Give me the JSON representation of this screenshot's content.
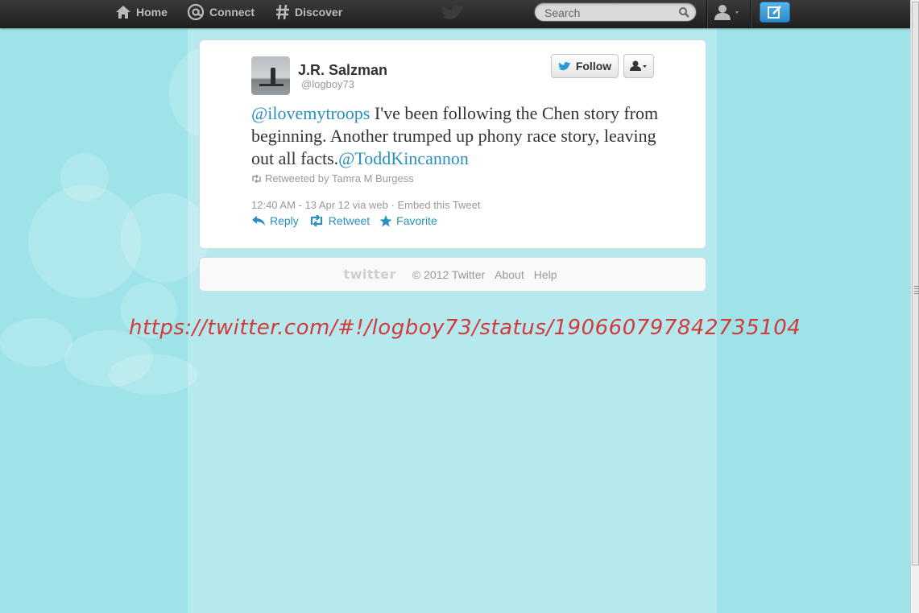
{
  "nav": {
    "home": "Home",
    "connect": "Connect",
    "discover": "Discover",
    "search_placeholder": "Search"
  },
  "tweet": {
    "fullname": "J.R. Salzman",
    "handle": "@logboy73",
    "follow_label": "Follow",
    "mention_1": "@ilovemytroops",
    "text": " I've been following the Chen story from beginning. Another trumped up phony race story, leaving out all facts.",
    "mention_2": "@ToddKincannon",
    "retweeted_by": "Retweeted by Tamra M Burgess",
    "timestamp": "12:40 AM - 13 Apr 12",
    "via": "via web",
    "separator": "·",
    "embed": "Embed this Tweet",
    "actions": {
      "reply": "Reply",
      "retweet": "Retweet",
      "favorite": "Favorite"
    }
  },
  "footer": {
    "logo": "twitter",
    "copyright": "© 2012 Twitter",
    "about": "About",
    "help": "Help"
  },
  "overlay_url": "https://twitter.com/#!/logboy73/status/190660797842735104",
  "colors": {
    "link": "#2a8fbd",
    "background": "#9ee3e8",
    "topbar": "#2a2a2a",
    "overlay_text": "#d23b3b"
  }
}
